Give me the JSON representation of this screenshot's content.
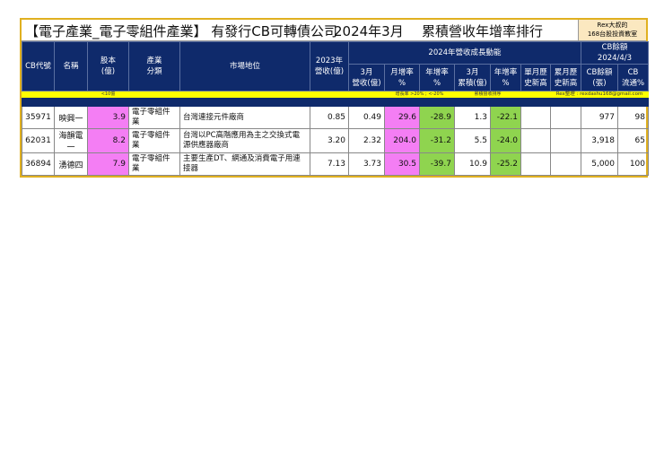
{
  "title": {
    "category": "【電子產業_電子零組件產業】 有發行CB可轉債公司",
    "period": "2024年3月",
    "ranking": "累積營收年增率排行",
    "rex_line1": "Rex大叔的",
    "rex_line2": "168台股投資教室"
  },
  "headers": {
    "code": "CB代號",
    "name": "名稱",
    "capital": "股本\n(億)",
    "industry": "產業\n分類",
    "market": "市場地位",
    "rev2023": "2023年\n營收(億)",
    "growth_group": "2024年營收成長動能",
    "mar_rev": "3月\n營收(億)",
    "mom": "月增率\n%",
    "yoy": "年增率\n%",
    "cum": "3月\n累積(億)",
    "cum_yoy": "年增率\n%",
    "month_high": "單月歷\n史新高",
    "cum_high": "累月歷\n史新高",
    "cb_group": "CB餘額\n2024/4/3",
    "cb_bal": "CB餘額\n(張)",
    "cb_float": "CB\n流通%"
  },
  "notes": {
    "capital": "<10億",
    "growth": "增長率 >20% ; <-20%",
    "cum": "累積營收排序",
    "contact": "Rex整理 : rexdashu168@gmail.com"
  },
  "rows": [
    {
      "code": "35971",
      "name": "映興一",
      "capital": "3.9",
      "industry": "電子零組件業",
      "market": "台灣連接元件廠商",
      "rev2023": "0.85",
      "mar_rev": "0.49",
      "mom": "29.6",
      "yoy": "-28.9",
      "cum": "1.3",
      "cum_yoy": "-22.1",
      "month_high": "",
      "cum_high": "",
      "cb_bal": "977",
      "cb_float": "98"
    },
    {
      "code": "62031",
      "name": "海韻電一",
      "capital": "8.2",
      "industry": "電子零組件業",
      "market": "台灣以PC高階應用為主之交換式電源供應器廠商",
      "rev2023": "3.20",
      "mar_rev": "2.32",
      "mom": "204.0",
      "yoy": "-31.2",
      "cum": "5.5",
      "cum_yoy": "-24.0",
      "month_high": "",
      "cum_high": "",
      "cb_bal": "3,918",
      "cb_float": "65"
    },
    {
      "code": "36894",
      "name": "湧德四",
      "capital": "7.9",
      "industry": "電子零組件業",
      "market": "主要生產DT、網通及消費電子用連接器",
      "rev2023": "7.13",
      "mar_rev": "3.73",
      "mom": "30.5",
      "yoy": "-39.7",
      "cum": "10.9",
      "cum_yoy": "-25.2",
      "month_high": "",
      "cum_high": "",
      "cb_bal": "5,000",
      "cb_float": "100"
    }
  ]
}
